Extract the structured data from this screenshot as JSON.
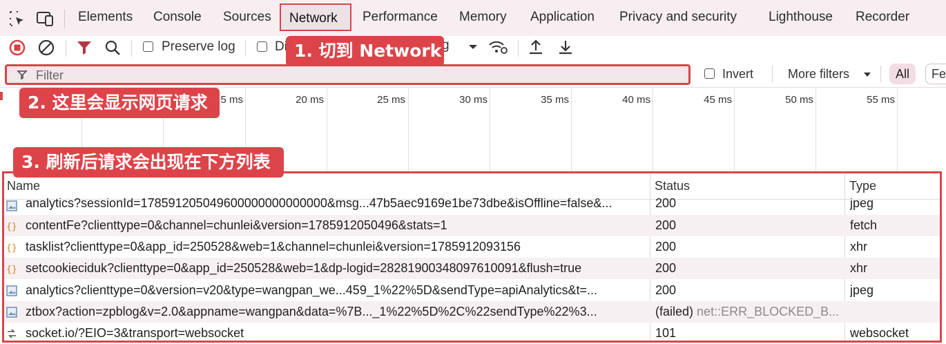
{
  "tabs": {
    "items": [
      "Elements",
      "Console",
      "Sources",
      "Network",
      "Performance",
      "Memory",
      "Application",
      "Privacy and security",
      "Lighthouse",
      "Recorder"
    ],
    "active": "Network"
  },
  "toolbar": {
    "preserve_log_label": "Preserve log",
    "disable_cache_label_partial": "Di",
    "throttling_partial": "g"
  },
  "filter": {
    "placeholder": "Filter",
    "invert_label": "Invert",
    "more_filters_label": "More filters",
    "type_all": "All",
    "type_fetch_partial": "Fet"
  },
  "timeline": {
    "ticks": [
      "5 ms",
      "20 ms",
      "25 ms",
      "30 ms",
      "35 ms",
      "40 ms",
      "45 ms",
      "50 ms",
      "55 ms"
    ]
  },
  "table": {
    "columns": [
      "Name",
      "Status",
      "Type"
    ],
    "rows": [
      {
        "icon": "image-icon",
        "name": "analytics?sessionId=178591205049600000000000000&msg...47b5aec9169e1be73dbe&isOffline=false&...",
        "status": "200",
        "status_detail": "",
        "type": "jpeg"
      },
      {
        "icon": "fetch-icon",
        "name": "contentFe?clienttype=0&channel=chunlei&version=1785912050496&stats=1",
        "status": "200",
        "status_detail": "",
        "type": "fetch"
      },
      {
        "icon": "fetch-icon",
        "name": "tasklist?clienttype=0&app_id=250528&web=1&channel=chunlei&version=1785912093156",
        "status": "200",
        "status_detail": "",
        "type": "xhr"
      },
      {
        "icon": "fetch-icon",
        "name": "setcookieciduk?clienttype=0&app_id=250528&web=1&dp-logid=28281900348097610091&flush=true",
        "status": "200",
        "status_detail": "",
        "type": "xhr"
      },
      {
        "icon": "image-icon",
        "name": "analytics?clienttype=0&version=v20&type=wangpan_we...459_1%22%5D&sendType=apiAnalytics&t=...",
        "status": "200",
        "status_detail": "",
        "type": "jpeg"
      },
      {
        "icon": "image-icon",
        "name": "ztbox?action=zpblog&v=2.0&appname=wangpan&data=%7B..._1%22%5D%2C%22sendType%22%3...",
        "status": "(failed)",
        "status_detail": "net::ERR_BLOCKED_B...",
        "type": ""
      },
      {
        "icon": "websocket-icon",
        "name": "socket.io/?EIO=3&transport=websocket",
        "status": "101",
        "status_detail": "",
        "type": "websocket"
      }
    ]
  },
  "annotations": {
    "step1": "1. 切到 Network",
    "step2": "2. 这里会显示网页请求",
    "step3": "3. 刷新后请求会出现在下方列表"
  },
  "colors": {
    "highlight": "#d8454a",
    "record_red": "#d93f3f",
    "tab_bar_bg": "#f8eef2"
  }
}
